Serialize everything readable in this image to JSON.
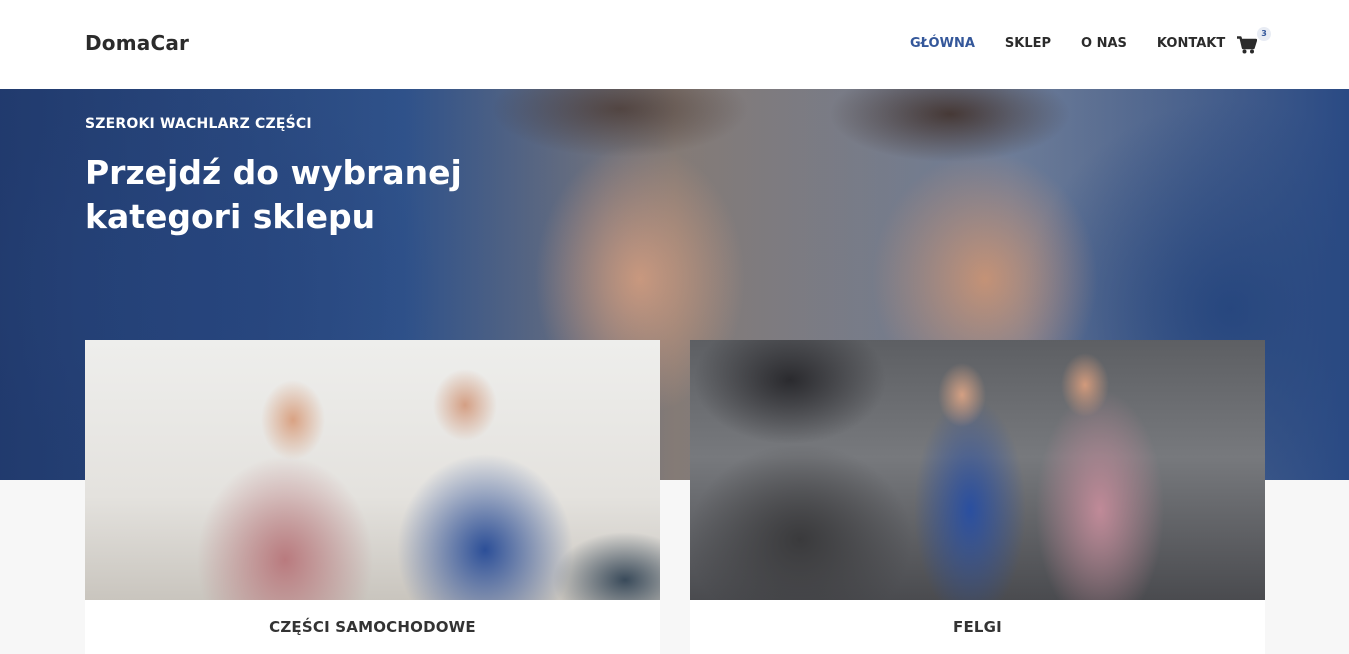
{
  "header": {
    "logo": "DomaCar",
    "nav": [
      {
        "label": "GŁÓWNA",
        "active": true
      },
      {
        "label": "SKLEP",
        "active": false
      },
      {
        "label": "O NAS",
        "active": false
      },
      {
        "label": "KONTAKT",
        "active": false
      }
    ],
    "cart": {
      "icon": "cart-icon",
      "count": "3"
    }
  },
  "hero": {
    "eyebrow": "SZEROKI WACHLARZ CZĘŚCI",
    "title": "Przejdź do wybranej kategori sklepu"
  },
  "categories": [
    {
      "label": "CZĘŚCI SAMOCHODOWE"
    },
    {
      "label": "FELGI"
    }
  ],
  "colors": {
    "accent": "#34579a",
    "text": "#2b2b2b",
    "background": "#f7f7f7"
  }
}
